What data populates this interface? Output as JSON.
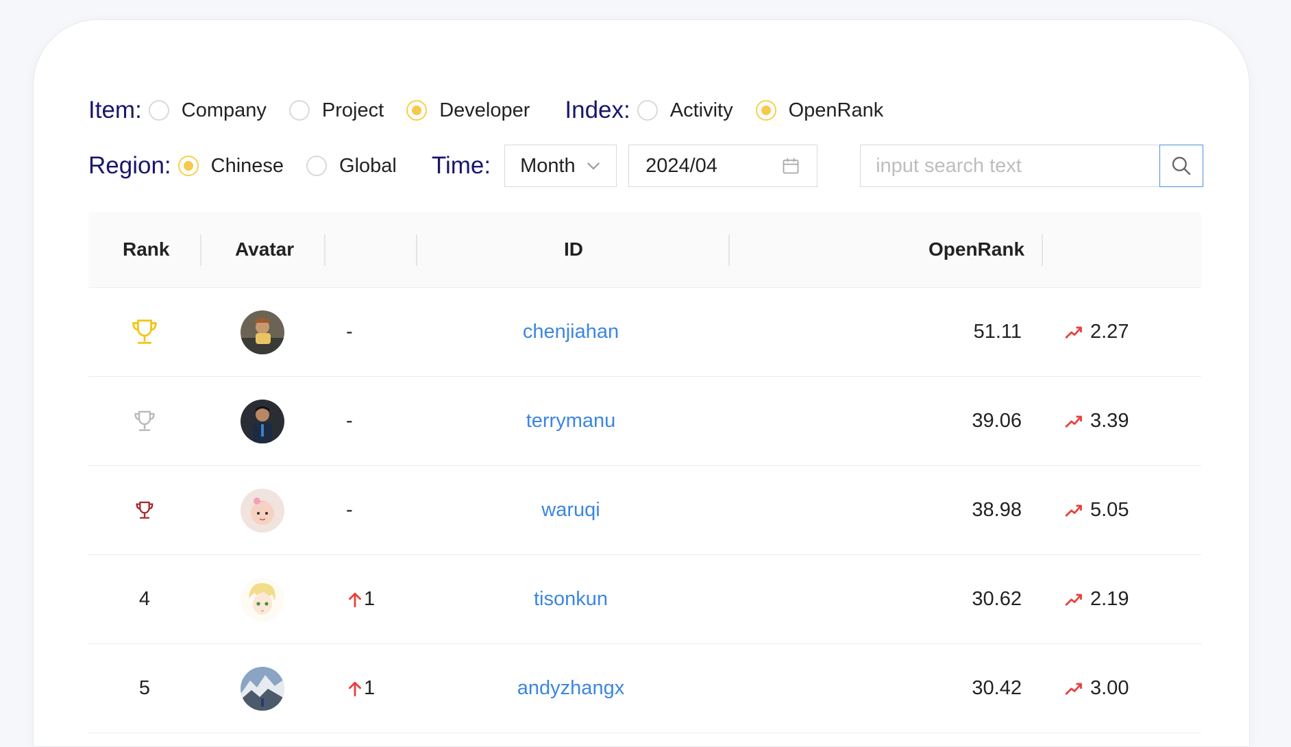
{
  "filters": {
    "item": {
      "label": "Item:",
      "options": [
        "Company",
        "Project",
        "Developer"
      ],
      "selected": "Developer"
    },
    "index": {
      "label": "Index:",
      "options": [
        "Activity",
        "OpenRank"
      ],
      "selected": "OpenRank"
    },
    "region": {
      "label": "Region:",
      "options": [
        "Chinese",
        "Global"
      ],
      "selected": "Chinese"
    },
    "time": {
      "label": "Time:",
      "period": "Month",
      "date": "2024/04"
    },
    "search": {
      "placeholder": "input search text"
    }
  },
  "table": {
    "headers": {
      "rank": "Rank",
      "avatar": "Avatar",
      "change": "",
      "id": "ID",
      "openrank": "OpenRank",
      "trend": ""
    },
    "rows": [
      {
        "rank": "1",
        "trophy": "gold",
        "change": "-",
        "id": "chenjiahan",
        "openrank": "51.11",
        "trend": "2.27"
      },
      {
        "rank": "2",
        "trophy": "silver",
        "change": "-",
        "id": "terrymanu",
        "openrank": "39.06",
        "trend": "3.39"
      },
      {
        "rank": "3",
        "trophy": "bronze",
        "change": "-",
        "id": "waruqi",
        "openrank": "38.98",
        "trend": "5.05"
      },
      {
        "rank": "4",
        "trophy": "",
        "change": "1",
        "id": "tisonkun",
        "openrank": "30.62",
        "trend": "2.19"
      },
      {
        "rank": "5",
        "trophy": "",
        "change": "1",
        "id": "andyzhangx",
        "openrank": "30.42",
        "trend": "3.00"
      }
    ]
  },
  "colors": {
    "accent_label": "#17176b",
    "link": "#3b86e0",
    "radio_checked": "#f7c948",
    "trophy_gold": "#f5c518",
    "trophy_silver": "#b8b8b8",
    "trophy_bronze": "#a4262c",
    "up_red": "#e8403a"
  },
  "icons": {
    "search": "search-icon",
    "calendar": "calendar-icon",
    "chevron": "chevron-down-icon",
    "trophy": "trophy-icon",
    "rise": "trend-up-icon",
    "arrow_up": "arrow-up-icon"
  }
}
